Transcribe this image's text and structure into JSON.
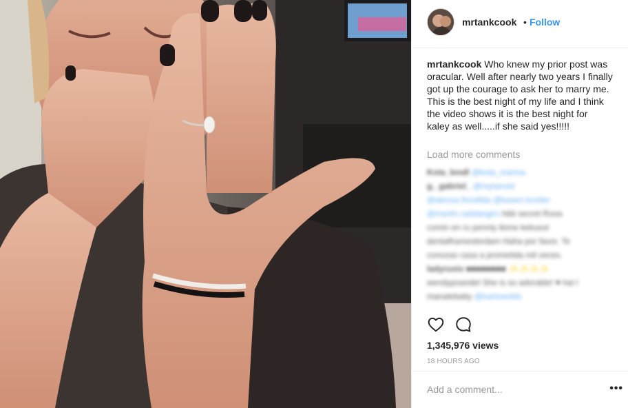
{
  "post": {
    "username": "mrtankcook",
    "separator": "•",
    "follow_label": "Follow",
    "caption_user": "mrtankcook",
    "caption_text": "Who knew my prior post was oracular. Well after nearly two years I finally got up the courage to ask her to marry me. This is the best night of my life and I think the video shows it is the best night for kaley as well.....if she said yes!!!!!",
    "load_more_label": "Load more comments",
    "comments": [
      {
        "user": "Kota_lendl",
        "text": "",
        "mentions": "@kota_marina"
      },
      {
        "user": "g._gabriel_",
        "text": "",
        "mentions": "@mytanvid"
      },
      {
        "user": "",
        "text": "",
        "mentions": "@alessa.fiorafida @kasen.kostler"
      },
      {
        "user": "",
        "text": "hiiiii secret Rosa",
        "mentions": "@martin.raddangirs"
      },
      {
        "user": "",
        "text": "comin en ru pennly ikime kekusol",
        "mentions": ""
      },
      {
        "user": "",
        "text": "dentalframesterdam Haha por favor. Te",
        "mentions": ""
      },
      {
        "user": "",
        "text": "conozas casa a prometida mil veces.",
        "mentions": ""
      },
      {
        "user": "ladyruvio",
        "text": "■■■■■■■■ ✨✨✨✨",
        "mentions": ""
      },
      {
        "user": "",
        "text": "wendypoandel She is so adorable! ♥ hai l",
        "mentions": ""
      },
      {
        "user": "",
        "text": "manalebaby",
        "mentions": "@karlowolds"
      }
    ],
    "views": "1,345,976 views",
    "time_ago": "18 HOURS AGO",
    "add_comment_placeholder": "Add a comment...",
    "more_label": "•••"
  },
  "icons": {
    "like": "heart-icon",
    "comment": "comment-bubble-icon",
    "more": "more-options-icon"
  },
  "colors": {
    "accent": "#3897f0",
    "text": "#262626",
    "muted": "#999999",
    "border": "#efefef"
  }
}
